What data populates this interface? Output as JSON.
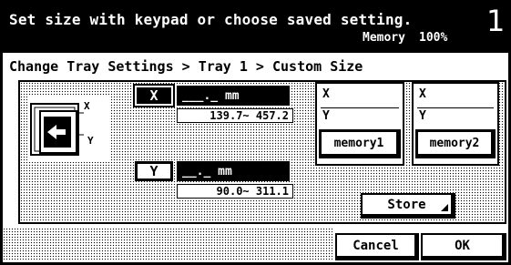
{
  "header": {
    "instruction": "Set size with keypad or choose saved setting.",
    "memory_label": "Memory",
    "memory_value": "100%",
    "page_number": "1"
  },
  "breadcrumb": "Change Tray Settings > Tray 1 > Custom Size",
  "x_axis": {
    "label": "X",
    "value": "___._ mm",
    "range": "139.7~ 457.2"
  },
  "y_axis": {
    "label": "Y",
    "value": "__._ mm",
    "range": "90.0~ 311.1"
  },
  "tray_icon": {
    "x_label": "X",
    "y_label": "Y"
  },
  "memories": [
    {
      "x_label": "X",
      "y_label": "Y",
      "button": "memory1"
    },
    {
      "x_label": "X",
      "y_label": "Y",
      "button": "memory2"
    }
  ],
  "buttons": {
    "store": "Store",
    "cancel": "Cancel",
    "ok": "OK"
  }
}
